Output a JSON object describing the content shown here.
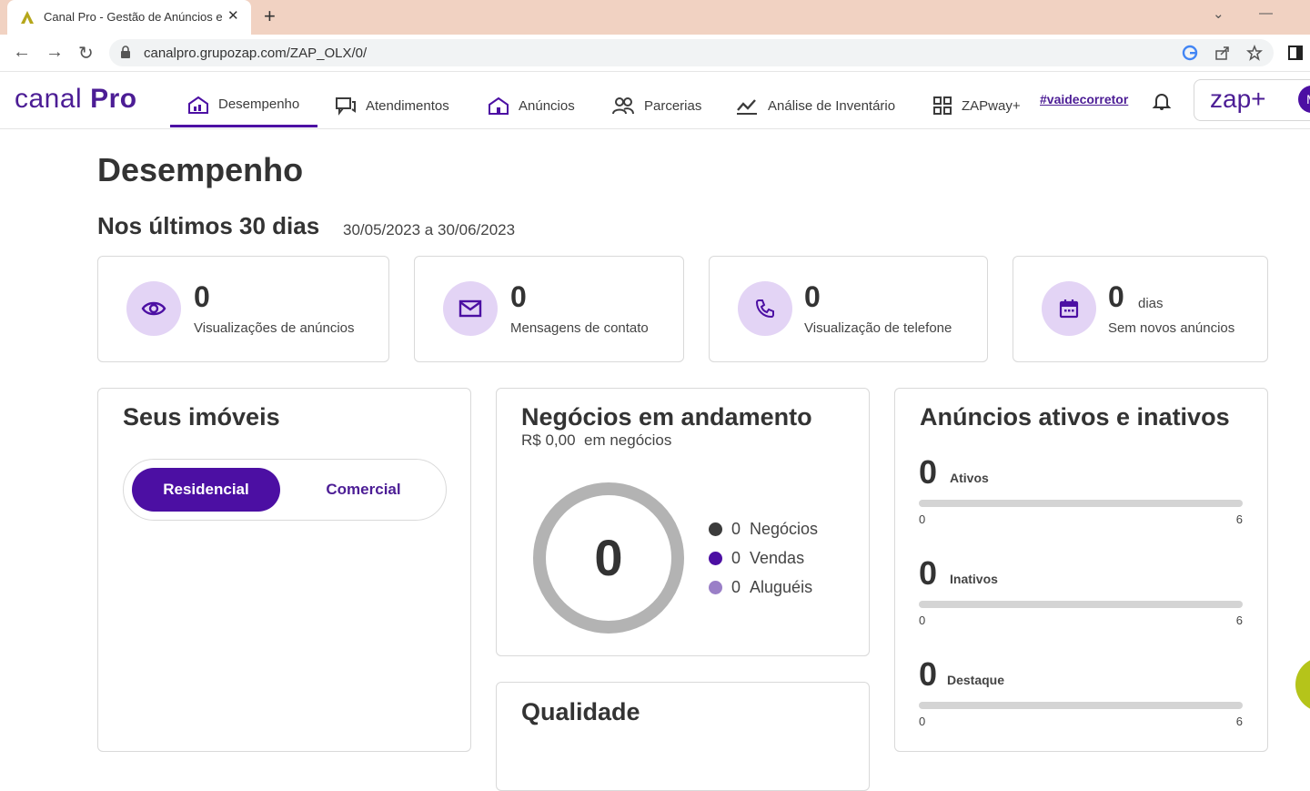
{
  "browser": {
    "tab_title": "Canal Pro - Gestão de Anúncios e",
    "url": "canalpro.grupozap.com/ZAP_OLX/0/"
  },
  "header": {
    "logo_left": "canal ",
    "logo_right": "Pro",
    "nav": [
      {
        "label": "Desempenho",
        "icon": "home-chart-icon",
        "active": true
      },
      {
        "label": "Atendimentos",
        "icon": "chat-icon"
      },
      {
        "label": "Anúncios",
        "icon": "home-icon"
      },
      {
        "label": "Parcerias",
        "icon": "people-icon"
      },
      {
        "label": "Análise de Inventário",
        "icon": "trend-icon"
      },
      {
        "label": "ZAPway+",
        "icon": "grid-icon"
      }
    ],
    "tagline": "#vaidecorretor",
    "zap_logo": "zap+",
    "avatar_initial": "M"
  },
  "page": {
    "title": "Desempenho",
    "period_label": "Nos últimos 30 dias",
    "period_range": "30/05/2023 a 30/06/2023"
  },
  "stats": [
    {
      "value": "0",
      "unit": "",
      "label": "Visualizações de anúncios",
      "icon": "eye-icon"
    },
    {
      "value": "0",
      "unit": "",
      "label": "Mensagens de contato",
      "icon": "mail-icon"
    },
    {
      "value": "0",
      "unit": "",
      "label": "Visualização de telefone",
      "icon": "phone-icon"
    },
    {
      "value": "0",
      "unit": "dias",
      "label": "Sem novos anúncios",
      "icon": "calendar-icon"
    }
  ],
  "imoveis": {
    "title": "Seus imóveis",
    "toggle_active": "Residencial",
    "toggle_inactive": "Comercial"
  },
  "negocios": {
    "title": "Negócios em andamento",
    "amount": "R$ 0,00",
    "amount_suffix": "em negócios",
    "total": "0",
    "legend": [
      {
        "value": "0",
        "label": "Negócios",
        "color": "#3b3b3b"
      },
      {
        "value": "0",
        "label": "Vendas",
        "color": "#4c0fa3"
      },
      {
        "value": "0",
        "label": "Aluguéis",
        "color": "#9a7fc7"
      }
    ]
  },
  "qualidade": {
    "title": "Qualidade"
  },
  "anuncios": {
    "title": "Anúncios ativos e inativos",
    "bars": [
      {
        "value": "0",
        "label": "Ativos",
        "min": "0",
        "max": "6",
        "fraction": 0
      },
      {
        "value": "0",
        "label": "Inativos",
        "min": "0",
        "max": "6",
        "fraction": 0
      },
      {
        "value": "0",
        "label": "Destaque",
        "min": "0",
        "max": "6",
        "fraction": 0
      }
    ]
  },
  "colors": {
    "brand": "#4c0fa3",
    "accent_light": "#e3d4f5",
    "fab": "#b5c41a"
  }
}
